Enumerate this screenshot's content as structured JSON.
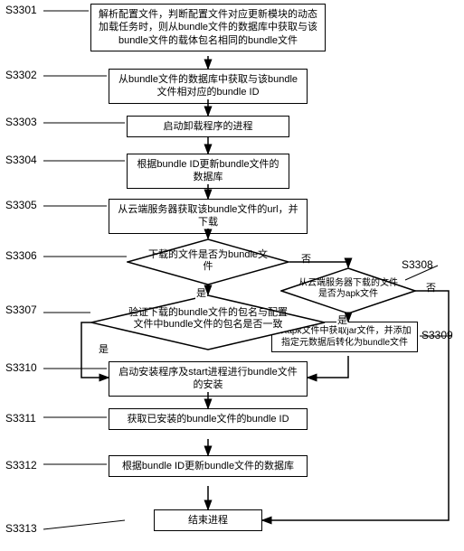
{
  "labels": {
    "s3301": "S3301",
    "s3302": "S3302",
    "s3303": "S3303",
    "s3304": "S3304",
    "s3305": "S3305",
    "s3306": "S3306",
    "s3307": "S3307",
    "s3308": "S3308",
    "s3309": "S3309",
    "s3310": "S3310",
    "s3311": "S3311",
    "s3312": "S3312",
    "s3313": "S3313"
  },
  "nodes": {
    "n3301": "解析配置文件，判断配置文件对应更新模块的动态加载任务时，则从bundle文件的数据库中获取与该bundle文件的载体包名相同的bundle文件",
    "n3302": "从bundle文件的数据库中获取与该bundle文件相对应的bundle ID",
    "n3303": "启动卸载程序的进程",
    "n3304": "根据bundle ID更新bundle文件的数据库",
    "n3305": "从云端服务器获取该bundle文件的url，并下载",
    "n3306": "下载的文件是否为bundle文件",
    "n3307": "验证下载的bundle文件的包名与配置文件中bundle文件的包名是否一致",
    "n3308": "从云端服务器下载的文件是否为apk文件",
    "n3309": "从apk文件中获取jar文件，并添加指定元数据后转化为bundle文件",
    "n3310": "启动安装程序及start进程进行bundle文件的安装",
    "n3311": "获取已安装的bundle文件的bundle ID",
    "n3312": "根据bundle ID更新bundle文件的数据库",
    "n3313": "结束进程"
  },
  "edges": {
    "yes": "是",
    "no": "否"
  }
}
